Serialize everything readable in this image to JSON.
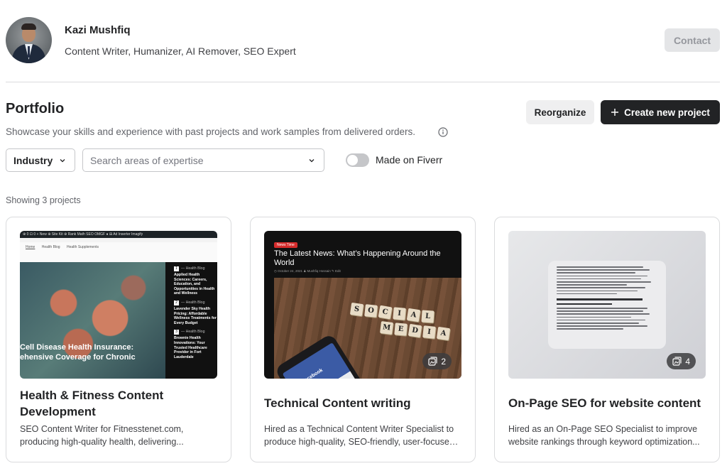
{
  "profile": {
    "name": "Kazi Mushfiq",
    "tagline": "Content Writer, Humanizer, AI Remover, SEO Expert",
    "contact_label": "Contact"
  },
  "portfolio": {
    "title": "Portfolio",
    "description": "Showcase your skills and experience with past projects and work samples from delivered orders.",
    "reorganize_label": "Reorganize",
    "create_label": "Create new project"
  },
  "filters": {
    "industry_label": "Industry",
    "search_placeholder": "Search areas of expertise",
    "toggle_label": "Made on Fiverr",
    "toggle_on": false
  },
  "showing_text": "Showing 3 projects",
  "projects": [
    {
      "title": "Health & Fitness Content Development",
      "desc_line1": "SEO Content Writer for Fitnesstenet.com,",
      "desc_line2": "producing high-quality health, delivering...",
      "thumb": {
        "topbar": "⊕ 0 ⊡ 0 + New ⊕ Site Kit ⊕ Rank Math SEO OMGF ● ⊞ Ad Inserter Imagify",
        "nav": [
          "Home",
          "Health Blog",
          "Health Supplements"
        ],
        "hero_line1": "Cell Disease Health Insurance:",
        "hero_line2": "ehensive Coverage for Chronic",
        "side_items": [
          {
            "num": "1",
            "cat": "— Health Blog",
            "title": "Applied Health Sciences: Careers, Education, and Opportunities in Health and Wellness"
          },
          {
            "num": "2",
            "cat": "— Health Blog",
            "title": "Lavender Sky Health Pricing: Affordable Wellness Treatments for Every Budget"
          },
          {
            "num": "3",
            "cat": "— Health Blog",
            "title": "Brownie Health Innovations: Your Trusted Healthcare Provider in Fort Lauderdale"
          }
        ]
      }
    },
    {
      "title": "Technical Content writing",
      "desc_line1": "Hired as a Technical Content Writer Specialist to",
      "desc_line2": "produce high-quality, SEO-friendly, user-focused,...",
      "count": "2",
      "thumb": {
        "tag": "News Time",
        "news_title": "The Latest News: What’s Happening Around the World",
        "meta": "◷ October 24, 2021  ♟ Mushfiq Hossain  ✎ Edit",
        "phone_text": "facebook",
        "tiles": [
          "S",
          "O",
          "C",
          "I",
          "A",
          "L",
          "M",
          "E",
          "D",
          "I",
          "A"
        ]
      }
    },
    {
      "title": "On-Page SEO for website content",
      "desc_line1": "Hired as an On-Page SEO Specialist to improve",
      "desc_line2": "website rankings through keyword optimization...",
      "count": "4",
      "thumb": {
        "heading": "How Health and Safety Executive Schools Benefit Educational Institutions"
      }
    }
  ]
}
